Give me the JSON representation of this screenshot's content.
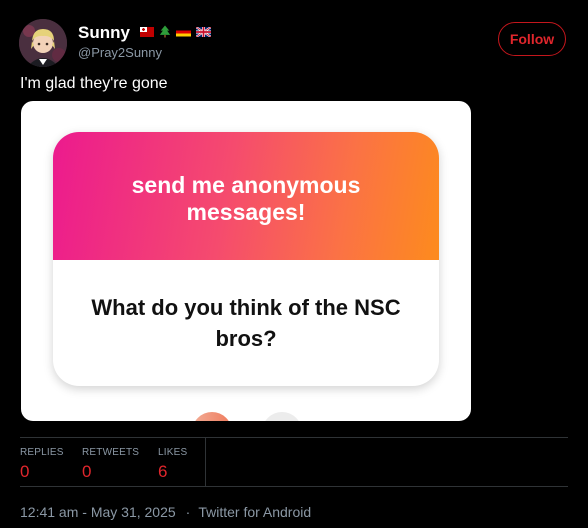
{
  "author": {
    "name": "Sunny",
    "handle": "@Pray2Sunny",
    "flags": [
      "tonga-flag",
      "christmas-tree-emoji",
      "germany-flag",
      "uk-flag"
    ]
  },
  "follow_label": "Follow",
  "tweet_text": "I'm glad they're gone",
  "media": {
    "card_title": "send me anonymous messages!",
    "card_question": "What do you think of the NSC bros?"
  },
  "stats": [
    {
      "label": "REPLIES",
      "value": "0"
    },
    {
      "label": "RETWEETS",
      "value": "0"
    },
    {
      "label": "LIKES",
      "value": "6"
    }
  ],
  "footer": {
    "timestamp": "12:41 am - May 31, 2025",
    "separator": "·",
    "source": "Twitter for Android"
  },
  "colors": {
    "background": "#000000",
    "accent_red": "#e0262c",
    "muted": "#8b98a5",
    "gradient_start": "#ec1a8e",
    "gradient_end": "#fd8b1d"
  }
}
